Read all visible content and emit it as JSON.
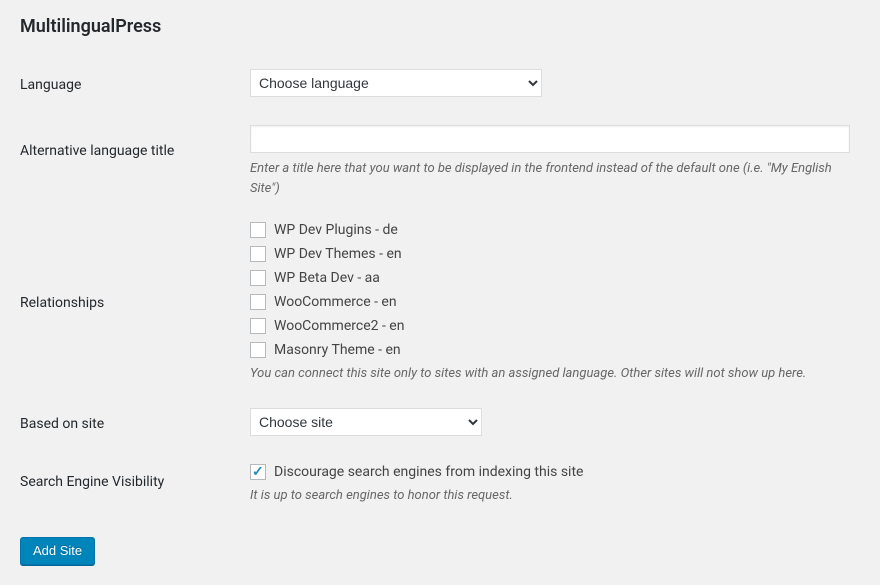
{
  "section_title": "MultilingualPress",
  "language": {
    "label": "Language",
    "selected": "Choose language"
  },
  "alt_title": {
    "label": "Alternative language title",
    "value": "",
    "description": "Enter a title here that you want to be displayed in the frontend instead of the default one (i.e. \"My English Site\")"
  },
  "relationships": {
    "label": "Relationships",
    "items": [
      {
        "label": "WP Dev Plugins - de",
        "checked": false
      },
      {
        "label": "WP Dev Themes - en",
        "checked": false
      },
      {
        "label": "WP Beta Dev - aa",
        "checked": false
      },
      {
        "label": "WooCommerce - en",
        "checked": false
      },
      {
        "label": "WooCommerce2 - en",
        "checked": false
      },
      {
        "label": "Masonry Theme - en",
        "checked": false
      }
    ],
    "description": "You can connect this site only to sites with an assigned language. Other sites will not show up here."
  },
  "based_on_site": {
    "label": "Based on site",
    "selected": "Choose site"
  },
  "search_engine": {
    "label": "Search Engine Visibility",
    "checkbox_label": "Discourage search engines from indexing this site",
    "checked": true,
    "description": "It is up to search engines to honor this request."
  },
  "submit_label": "Add Site"
}
